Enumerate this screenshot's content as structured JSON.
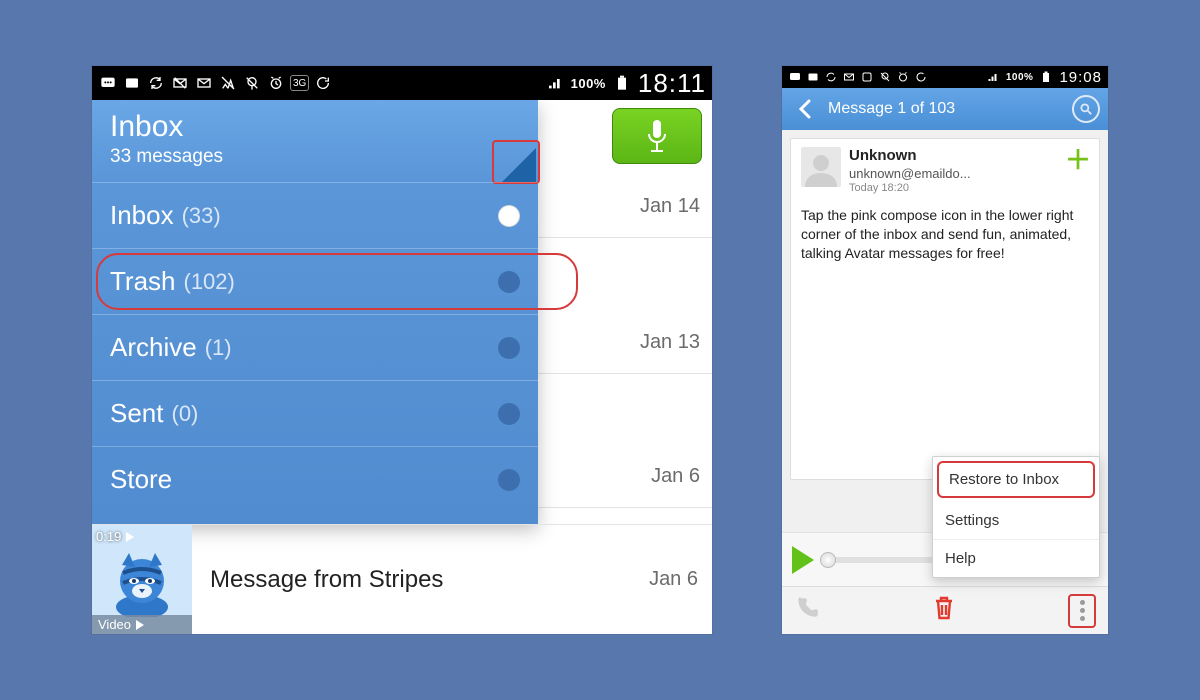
{
  "left": {
    "status": {
      "battery": "100%",
      "time": "18:11",
      "net_label": "3G"
    },
    "header": {
      "title": "Inbox",
      "subtitle": "33 messages"
    },
    "mic_button": "Voice compose",
    "folders": [
      {
        "label": "Inbox",
        "count": "(33)",
        "selected": true
      },
      {
        "label": "Trash",
        "count": "(102)",
        "highlighted": true
      },
      {
        "label": "Archive",
        "count": "(1)"
      },
      {
        "label": "Sent",
        "count": "(0)"
      },
      {
        "label": "Store",
        "count": ""
      }
    ],
    "visible_dates": [
      "Jan 14",
      "Jan 13",
      "Jan 6"
    ],
    "message": {
      "title": "Message from Stripes",
      "date": "Jan 6",
      "thumb_duration": "0:19",
      "thumb_label": "Video"
    }
  },
  "right": {
    "status": {
      "battery": "100%",
      "time": "19:08"
    },
    "header_title": "Message 1 of 103",
    "sender": {
      "name": "Unknown",
      "address": "unknown@emaildo...",
      "time": "Today 18:20"
    },
    "body": "Tap the pink compose icon in the lower right corner of the inbox and send fun, animated, talking Avatar messages for free!",
    "menu": {
      "restore": "Restore to Inbox",
      "settings": "Settings",
      "help": "Help"
    }
  }
}
